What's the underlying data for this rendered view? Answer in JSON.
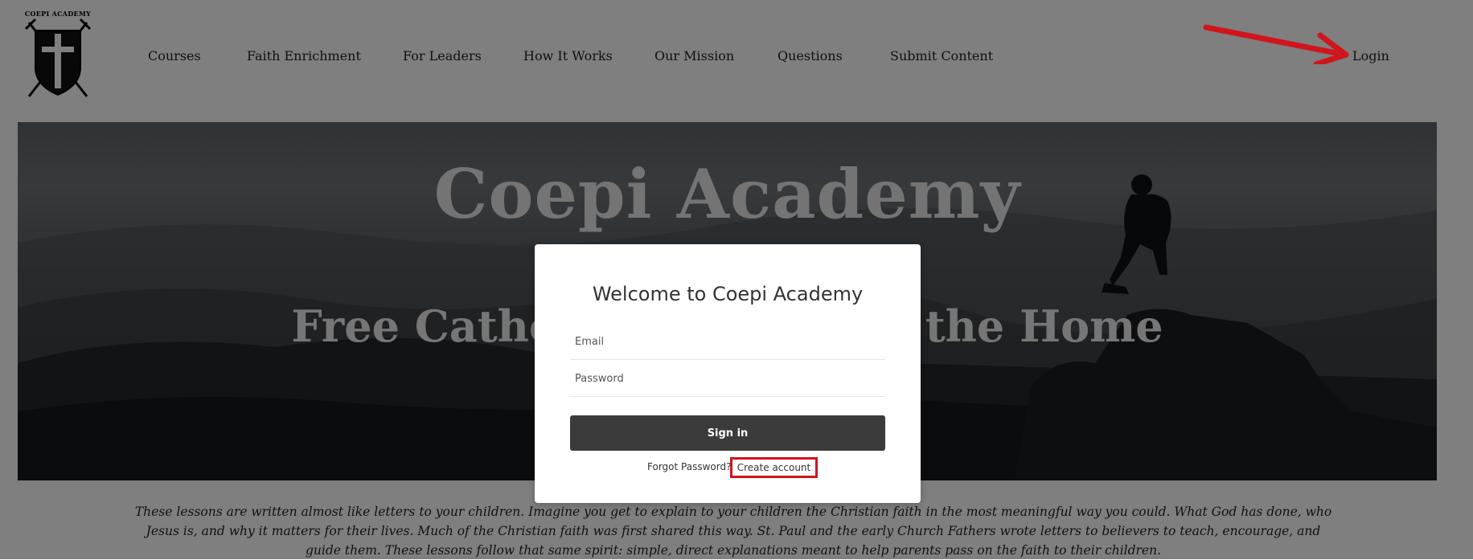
{
  "logo": {
    "text": "COEPI ACADEMY",
    "icon": "shield-crossed-swords-icon"
  },
  "nav": {
    "items": [
      {
        "label": "Courses"
      },
      {
        "label": "Faith Enrichment"
      },
      {
        "label": "For Leaders"
      },
      {
        "label": "How It Works"
      },
      {
        "label": "Our Mission"
      },
      {
        "label": "Questions"
      },
      {
        "label": "Submit Content"
      }
    ],
    "login_label": "Login"
  },
  "hero": {
    "title": "Coepi Academy",
    "subtitle": "Free Catholic Lessons for the Home"
  },
  "intro": {
    "text": "These lessons are written almost like letters to your children. Imagine you get to explain to your children the Christian faith in the most meaningful way you could. What God has done, who Jesus is, and why it matters for their lives. Much of the Christian faith was first shared this way. St. Paul and the early Church Fathers wrote letters to believers to teach, encourage, and guide them. These lessons follow that same spirit: simple, direct explanations meant to help parents pass on the faith to their children."
  },
  "modal": {
    "title": "Welcome to Coepi Academy",
    "email_placeholder": "Email",
    "email_value": "",
    "password_placeholder": "Password",
    "password_value": "",
    "signin_label": "Sign in",
    "forgot_label": "Forgot Password?",
    "create_label": "Create account"
  },
  "colors": {
    "annotation_red": "#d0151c",
    "button_dark": "#3b3b3b",
    "overlay": "rgba(0,0,0,0.5)"
  }
}
